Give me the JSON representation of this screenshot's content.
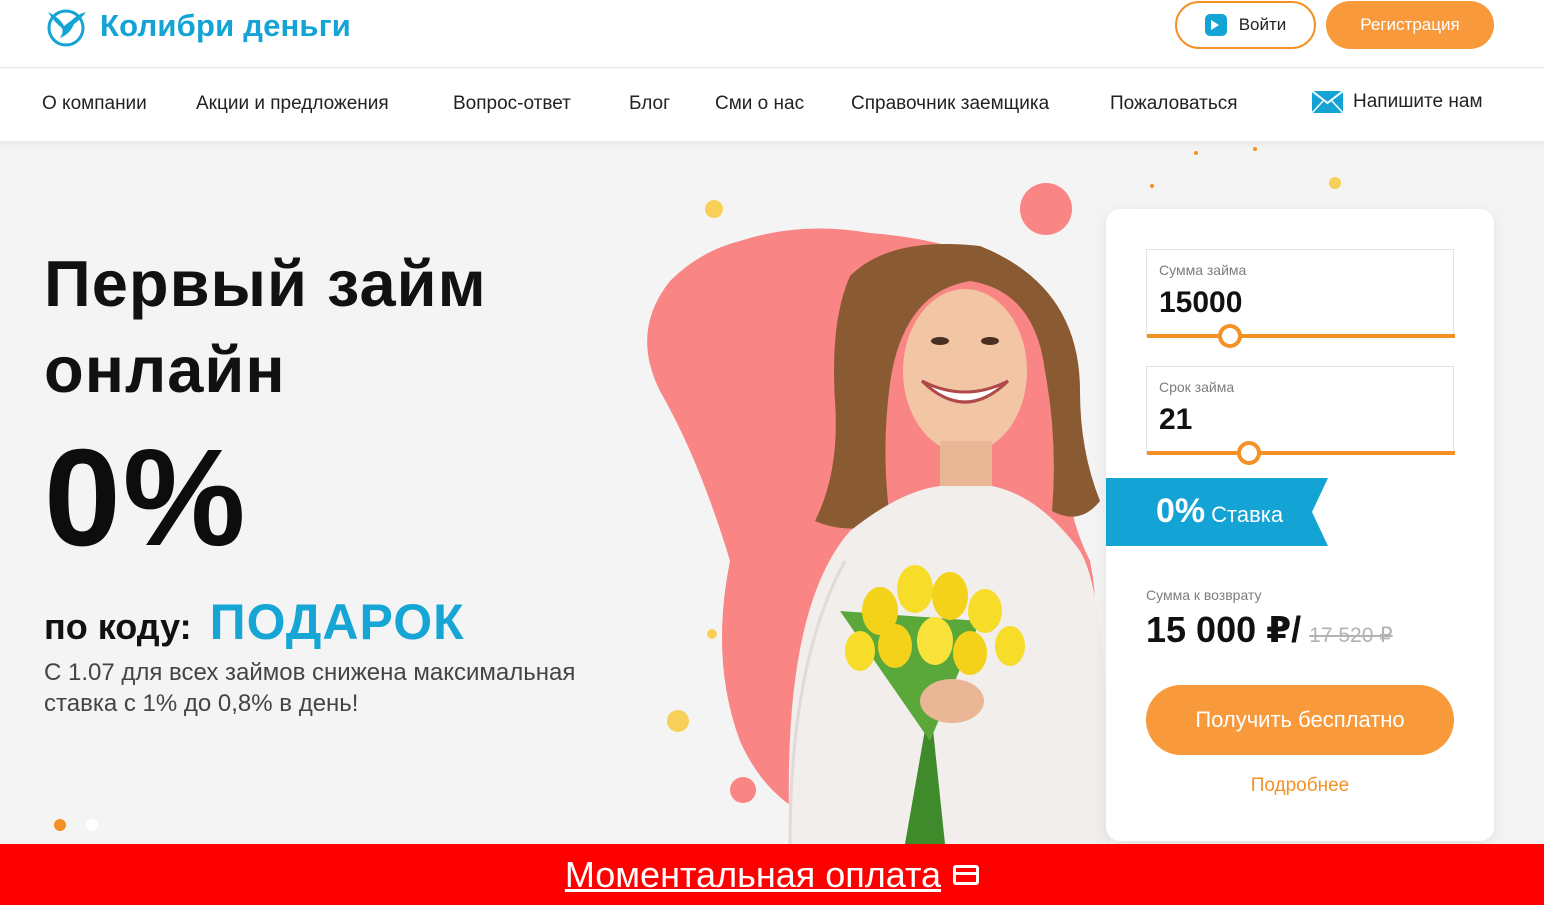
{
  "header": {
    "logo_text": "Колибри деньги",
    "login_label": "Войти",
    "register_label": "Регистрация"
  },
  "nav": {
    "items": [
      {
        "label": "О компании"
      },
      {
        "label": "Акции и предложения"
      },
      {
        "label": "Вопрос-ответ"
      },
      {
        "label": "Блог"
      },
      {
        "label": "Сми о нас"
      },
      {
        "label": "Справочник заемщика"
      },
      {
        "label": "Пожаловаться"
      }
    ],
    "contact_label": "Напишите нам"
  },
  "hero": {
    "title_line1": "Первый займ",
    "title_line2": "онлайн",
    "percent": "0%",
    "code_label": "по коду:",
    "code_value": "ПОДАРОК",
    "note": "С 1.07 для всех займов снижена максимальная ставка с 1% до 0,8% в день!",
    "slide_count": 2,
    "active_slide": 1
  },
  "calculator": {
    "amount_label": "Сумма займа",
    "amount_value": "15000",
    "amount_slider_fraction": 0.27,
    "term_label": "Срок займа",
    "term_value": "21",
    "term_slider_fraction": 0.33,
    "rate_big": "0%",
    "rate_small": "Ставка",
    "return_label": "Сумма к возврату",
    "return_value": "15 000 ₽/",
    "return_old": "17 520 ₽",
    "get_button": "Получить бесплатно",
    "more_link": "Подробнее"
  },
  "paybar": {
    "label": "Моментальная оплата"
  },
  "colors": {
    "brand_blue": "#13a3d4",
    "accent_orange": "#f89a3c",
    "pay_red": "#ff0000",
    "blob_pink": "#f98585"
  },
  "icons": [
    "hummingbird-logo-icon",
    "login-arrow-icon",
    "mail-icon",
    "card-icon"
  ]
}
